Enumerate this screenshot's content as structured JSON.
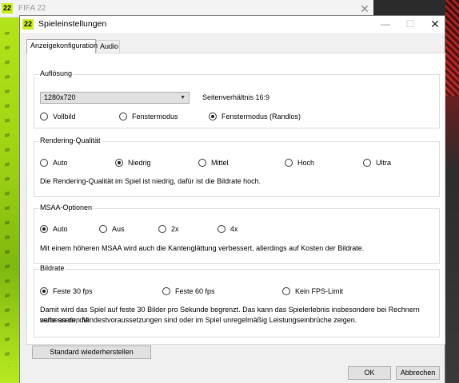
{
  "parent_window": {
    "logo": "22",
    "title": "FIFA 22",
    "close": "✕"
  },
  "dialog": {
    "logo": "22",
    "title": "Spieleinstellungen",
    "controls": {
      "minimize": "—",
      "maximize": "☐",
      "close": "✕"
    }
  },
  "tabs": [
    {
      "label": "Anzeigekonfiguration",
      "active": true
    },
    {
      "label": "Audio",
      "active": false
    }
  ],
  "aufloesung": {
    "label": "Auflösung",
    "resolution_value": "1280x720",
    "dropdown_arrow": "▼",
    "aspect_ratio": "Seitenverhältnis 16:9",
    "modes": [
      {
        "label": "Vollbild",
        "selected": false
      },
      {
        "label": "Fenstermodus",
        "selected": false
      },
      {
        "label": "Fenstermodus (Randlos)",
        "selected": true
      }
    ]
  },
  "rendering": {
    "label": "Rendering-Qualität",
    "options": [
      {
        "label": "Auto",
        "selected": false
      },
      {
        "label": "Niedrig",
        "selected": true
      },
      {
        "label": "Mittel",
        "selected": false
      },
      {
        "label": "Hoch",
        "selected": false
      },
      {
        "label": "Ultra",
        "selected": false
      }
    ],
    "description": "Die Rendering-Qualität im Spiel ist niedrig, dafür ist die Bildrate hoch."
  },
  "msaa": {
    "label": "MSAA-Optionen",
    "options": [
      {
        "label": "Auto",
        "selected": true
      },
      {
        "label": "Aus",
        "selected": false
      },
      {
        "label": "2x",
        "selected": false
      },
      {
        "label": "4x",
        "selected": false
      }
    ],
    "description": "Mit einem höheren MSAA wird auch die Kantenglättung verbessert, allerdings auf Kosten der Bildrate."
  },
  "bildrate": {
    "label": "Bildrate",
    "options": [
      {
        "label": "Feste 30 fps",
        "selected": true
      },
      {
        "label": "Feste 60 fps",
        "selected": false
      },
      {
        "label": "Kein FPS-Limit",
        "selected": false
      }
    ],
    "description_line1": "Damit wird das Spiel auf feste 30 Bilder pro Sekunde begrenzt. Das kann das Spielerlebnis insbesondere bei Rechnern verbessern, die",
    "description_line2": "nahe an den Mindestvoraussetzungen sind oder im Spiel unregelmäßig Leistungseinbrüche zeigen."
  },
  "buttons": {
    "reset": "Standard wiederherstellen",
    "ok": "OK",
    "cancel": "Abbrechen"
  }
}
